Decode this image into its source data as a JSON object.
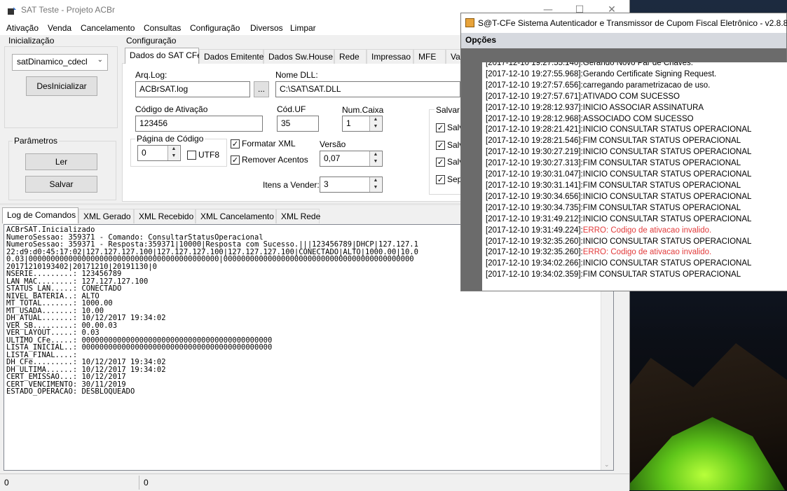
{
  "window": {
    "title": "SAT Teste - Projeto ACBr",
    "minimize": "—",
    "maximize": "☐",
    "close": "✕"
  },
  "menu": [
    "Ativação",
    "Venda",
    "Cancelamento",
    "Consultas",
    "Configuração",
    "Diversos",
    "Limpar"
  ],
  "inicializacao": {
    "label": "Inicialização",
    "model_select": "satDinamico_cdecl",
    "deinit_button": "DesInicializar"
  },
  "parametros": {
    "label": "Parâmetros",
    "read_button": "Ler",
    "save_button": "Salvar"
  },
  "configuracao": {
    "label": "Configuração",
    "tabs": [
      "Dados do SAT CFe",
      "Dados Emitente",
      "Dados Sw.House",
      "Rede",
      "Impressao",
      "MFE",
      "Va"
    ],
    "arq_log_label": "Arq.Log:",
    "arq_log_value": "ACBrSAT.log",
    "browse_button": "...",
    "nome_dll_label": "Nome DLL:",
    "nome_dll_value": "C:\\SAT\\SAT.DLL",
    "codigo_ativacao_label": "Código de Ativação",
    "codigo_ativacao_value": "123456",
    "cod_uf_label": "Cód.UF",
    "cod_uf_value": "35",
    "num_caixa_label": "Num.Caixa",
    "num_caixa_value": "1",
    "pagina_codigo_label": "Página de Código",
    "pagina_codigo_value": "0",
    "utf8_label": "UTF8",
    "formatar_xml_label": "Formatar XML",
    "remover_acentos_label": "Remover Acentos",
    "versao_label": "Versão",
    "versao_value": "0,07",
    "itens_vender_label": "Itens a Vender:",
    "itens_vender_value": "3",
    "salvar_label": "Salvar X",
    "salvar_checks": [
      "Salv",
      "Salv",
      "Salv",
      "Sep"
    ]
  },
  "log_tabs": [
    "Log de Comandos",
    "XML Gerado",
    "XML Recebido",
    "XML Cancelamento",
    "XML Rede"
  ],
  "log_text": "ACBrSAT.Inicializado\nNumeroSessao: 359371 - Comando: ConsultarStatusOperacional\nNumeroSessao: 359371 - Resposta:359371|10000|Resposta com Sucesso.|||123456789|DHCP|127.127.1\n22:d9:d0:45:17:02|127.127.127.100|127.127.127.100|127.127.127.100|CONECTADO|ALTO|1000.00|10.0\n0.03|0000000000000000000000000000000000000000000|0000000000000000000000000000000000000000000\n20171210193402|20171210|20191130|0\nNSERIE.........: 123456789\nLAN_MAC........: 127.127.127.100\nSTATUS_LAN.....: CONECTADO\nNIVEL_BATERIA..: ALTO\nMT_TOTAL.......: 1000.00\nMT_USADA.......: 10.00\nDH_ATUAL.......: 10/12/2017 19:34:02\nVER_SB.........: 00.00.03\nVER_LAYOUT.....: 0.03\nULTIMO_CFe.....: 0000000000000000000000000000000000000000000\nLISTA_INICIAL..: 0000000000000000000000000000000000000000000\nLISTA_FINAL....: \nDH_CFe.........: 10/12/2017 19:34:02\nDH_ULTIMA......: 10/12/2017 19:34:02\nCERT_EMISSAO...: 10/12/2017\nCERT_VENCIMENTO: 30/11/2019\nESTADO_OPERACAO: DESBLOQUEADO",
  "status_bar": {
    "left": "0",
    "right": "0"
  },
  "sat_window": {
    "title": "S@T-CFe Sistema Autenticador e Transmissor de Cupom Fiscal Eletrônico - v2.8.8",
    "menu": "Opções",
    "log_lines": [
      {
        "text": "[2017-12-10 19:27:55.140]:Gerando Novo Par de Chaves.",
        "error": false
      },
      {
        "text": "[2017-12-10 19:27:55.968]:Gerando Certificate Signing Request.",
        "error": false
      },
      {
        "text": "[2017-12-10 19:27:57.656]:carregando parametrizacao de uso.",
        "error": false
      },
      {
        "text": "[2017-12-10 19:27:57.671]:ATIVADO COM SUCESSO",
        "error": false
      },
      {
        "text": "[2017-12-10 19:28:12.937]:INICIO ASSOCIAR ASSINATURA",
        "error": false
      },
      {
        "text": "[2017-12-10 19:28:12.968]:ASSOCIADO COM SUCESSO",
        "error": false
      },
      {
        "text": "[2017-12-10 19:28:21.421]:INICIO CONSULTAR STATUS OPERACIONAL",
        "error": false
      },
      {
        "text": "[2017-12-10 19:28:21.546]:FIM CONSULTAR STATUS OPERACIONAL",
        "error": false
      },
      {
        "text": "[2017-12-10 19:30:27.219]:INICIO CONSULTAR STATUS OPERACIONAL",
        "error": false
      },
      {
        "text": "[2017-12-10 19:30:27.313]:FIM CONSULTAR STATUS OPERACIONAL",
        "error": false
      },
      {
        "text": "[2017-12-10 19:30:31.047]:INICIO CONSULTAR STATUS OPERACIONAL",
        "error": false
      },
      {
        "text": "[2017-12-10 19:30:31.141]:FIM CONSULTAR STATUS OPERACIONAL",
        "error": false
      },
      {
        "text": "[2017-12-10 19:30:34.656]:INICIO CONSULTAR STATUS OPERACIONAL",
        "error": false
      },
      {
        "text": "[2017-12-10 19:30:34.735]:FIM CONSULTAR STATUS OPERACIONAL",
        "error": false
      },
      {
        "text": "[2017-12-10 19:31:49.212]:INICIO CONSULTAR STATUS OPERACIONAL",
        "error": false
      },
      {
        "text": "[2017-12-10 19:31:49.224]:",
        "err": "ERRO: Codigo de ativacao invalido.",
        "error": true
      },
      {
        "text": "[2017-12-10 19:32:35.260]:INICIO CONSULTAR STATUS OPERACIONAL",
        "error": false
      },
      {
        "text": "[2017-12-10 19:32:35.260]:",
        "err": "ERRO: Codigo de ativacao invalido.",
        "error": true
      },
      {
        "text": "[2017-12-10 19:34:02.266]:INICIO CONSULTAR STATUS OPERACIONAL",
        "error": false
      },
      {
        "text": "[2017-12-10 19:34:02.359]:FIM CONSULTAR STATUS OPERACIONAL",
        "error": false
      }
    ]
  }
}
